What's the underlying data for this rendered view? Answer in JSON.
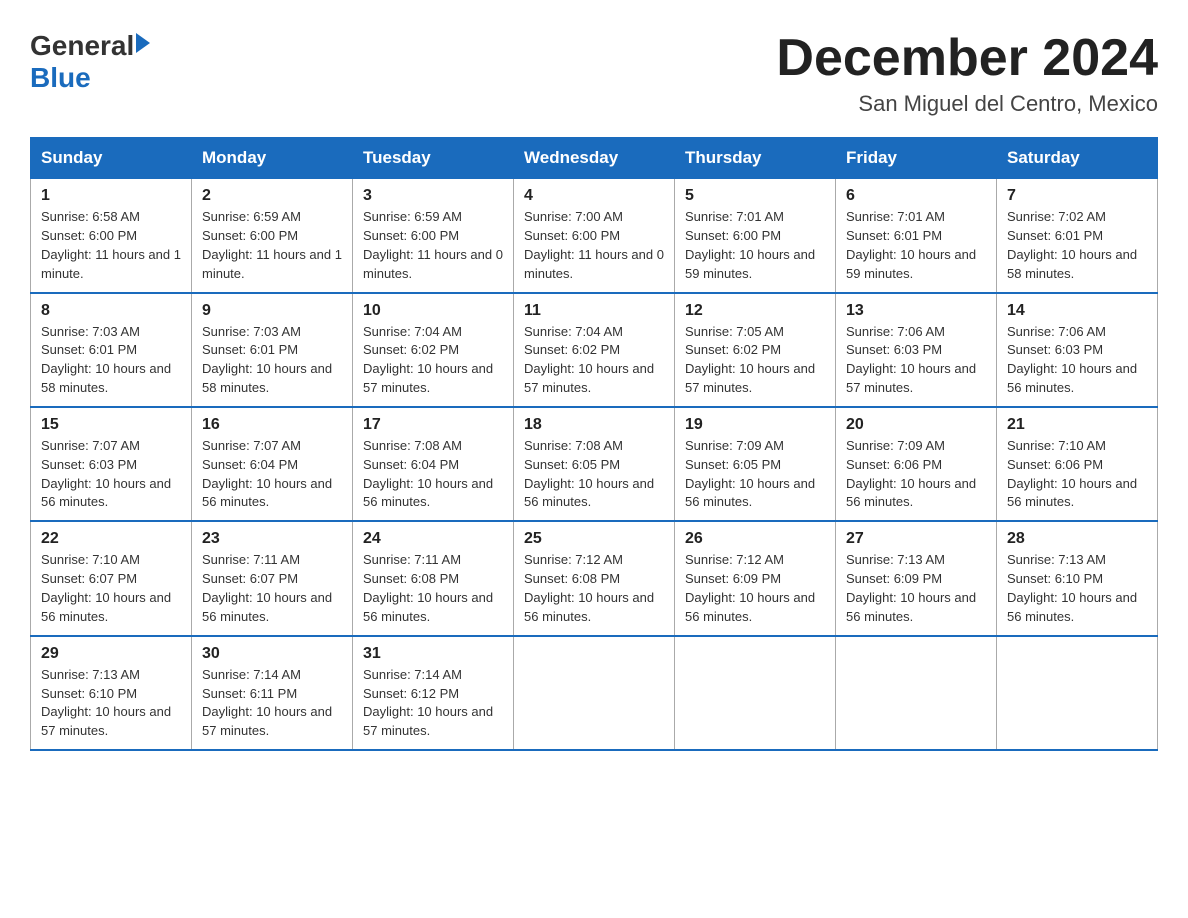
{
  "logo": {
    "text_general": "General",
    "text_blue": "Blue"
  },
  "title": "December 2024",
  "location": "San Miguel del Centro, Mexico",
  "days_of_week": [
    "Sunday",
    "Monday",
    "Tuesday",
    "Wednesday",
    "Thursday",
    "Friday",
    "Saturday"
  ],
  "weeks": [
    [
      {
        "day": "1",
        "sunrise": "6:58 AM",
        "sunset": "6:00 PM",
        "daylight": "11 hours and 1 minute."
      },
      {
        "day": "2",
        "sunrise": "6:59 AM",
        "sunset": "6:00 PM",
        "daylight": "11 hours and 1 minute."
      },
      {
        "day": "3",
        "sunrise": "6:59 AM",
        "sunset": "6:00 PM",
        "daylight": "11 hours and 0 minutes."
      },
      {
        "day": "4",
        "sunrise": "7:00 AM",
        "sunset": "6:00 PM",
        "daylight": "11 hours and 0 minutes."
      },
      {
        "day": "5",
        "sunrise": "7:01 AM",
        "sunset": "6:00 PM",
        "daylight": "10 hours and 59 minutes."
      },
      {
        "day": "6",
        "sunrise": "7:01 AM",
        "sunset": "6:01 PM",
        "daylight": "10 hours and 59 minutes."
      },
      {
        "day": "7",
        "sunrise": "7:02 AM",
        "sunset": "6:01 PM",
        "daylight": "10 hours and 58 minutes."
      }
    ],
    [
      {
        "day": "8",
        "sunrise": "7:03 AM",
        "sunset": "6:01 PM",
        "daylight": "10 hours and 58 minutes."
      },
      {
        "day": "9",
        "sunrise": "7:03 AM",
        "sunset": "6:01 PM",
        "daylight": "10 hours and 58 minutes."
      },
      {
        "day": "10",
        "sunrise": "7:04 AM",
        "sunset": "6:02 PM",
        "daylight": "10 hours and 57 minutes."
      },
      {
        "day": "11",
        "sunrise": "7:04 AM",
        "sunset": "6:02 PM",
        "daylight": "10 hours and 57 minutes."
      },
      {
        "day": "12",
        "sunrise": "7:05 AM",
        "sunset": "6:02 PM",
        "daylight": "10 hours and 57 minutes."
      },
      {
        "day": "13",
        "sunrise": "7:06 AM",
        "sunset": "6:03 PM",
        "daylight": "10 hours and 57 minutes."
      },
      {
        "day": "14",
        "sunrise": "7:06 AM",
        "sunset": "6:03 PM",
        "daylight": "10 hours and 56 minutes."
      }
    ],
    [
      {
        "day": "15",
        "sunrise": "7:07 AM",
        "sunset": "6:03 PM",
        "daylight": "10 hours and 56 minutes."
      },
      {
        "day": "16",
        "sunrise": "7:07 AM",
        "sunset": "6:04 PM",
        "daylight": "10 hours and 56 minutes."
      },
      {
        "day": "17",
        "sunrise": "7:08 AM",
        "sunset": "6:04 PM",
        "daylight": "10 hours and 56 minutes."
      },
      {
        "day": "18",
        "sunrise": "7:08 AM",
        "sunset": "6:05 PM",
        "daylight": "10 hours and 56 minutes."
      },
      {
        "day": "19",
        "sunrise": "7:09 AM",
        "sunset": "6:05 PM",
        "daylight": "10 hours and 56 minutes."
      },
      {
        "day": "20",
        "sunrise": "7:09 AM",
        "sunset": "6:06 PM",
        "daylight": "10 hours and 56 minutes."
      },
      {
        "day": "21",
        "sunrise": "7:10 AM",
        "sunset": "6:06 PM",
        "daylight": "10 hours and 56 minutes."
      }
    ],
    [
      {
        "day": "22",
        "sunrise": "7:10 AM",
        "sunset": "6:07 PM",
        "daylight": "10 hours and 56 minutes."
      },
      {
        "day": "23",
        "sunrise": "7:11 AM",
        "sunset": "6:07 PM",
        "daylight": "10 hours and 56 minutes."
      },
      {
        "day": "24",
        "sunrise": "7:11 AM",
        "sunset": "6:08 PM",
        "daylight": "10 hours and 56 minutes."
      },
      {
        "day": "25",
        "sunrise": "7:12 AM",
        "sunset": "6:08 PM",
        "daylight": "10 hours and 56 minutes."
      },
      {
        "day": "26",
        "sunrise": "7:12 AM",
        "sunset": "6:09 PM",
        "daylight": "10 hours and 56 minutes."
      },
      {
        "day": "27",
        "sunrise": "7:13 AM",
        "sunset": "6:09 PM",
        "daylight": "10 hours and 56 minutes."
      },
      {
        "day": "28",
        "sunrise": "7:13 AM",
        "sunset": "6:10 PM",
        "daylight": "10 hours and 56 minutes."
      }
    ],
    [
      {
        "day": "29",
        "sunrise": "7:13 AM",
        "sunset": "6:10 PM",
        "daylight": "10 hours and 57 minutes."
      },
      {
        "day": "30",
        "sunrise": "7:14 AM",
        "sunset": "6:11 PM",
        "daylight": "10 hours and 57 minutes."
      },
      {
        "day": "31",
        "sunrise": "7:14 AM",
        "sunset": "6:12 PM",
        "daylight": "10 hours and 57 minutes."
      },
      null,
      null,
      null,
      null
    ]
  ]
}
